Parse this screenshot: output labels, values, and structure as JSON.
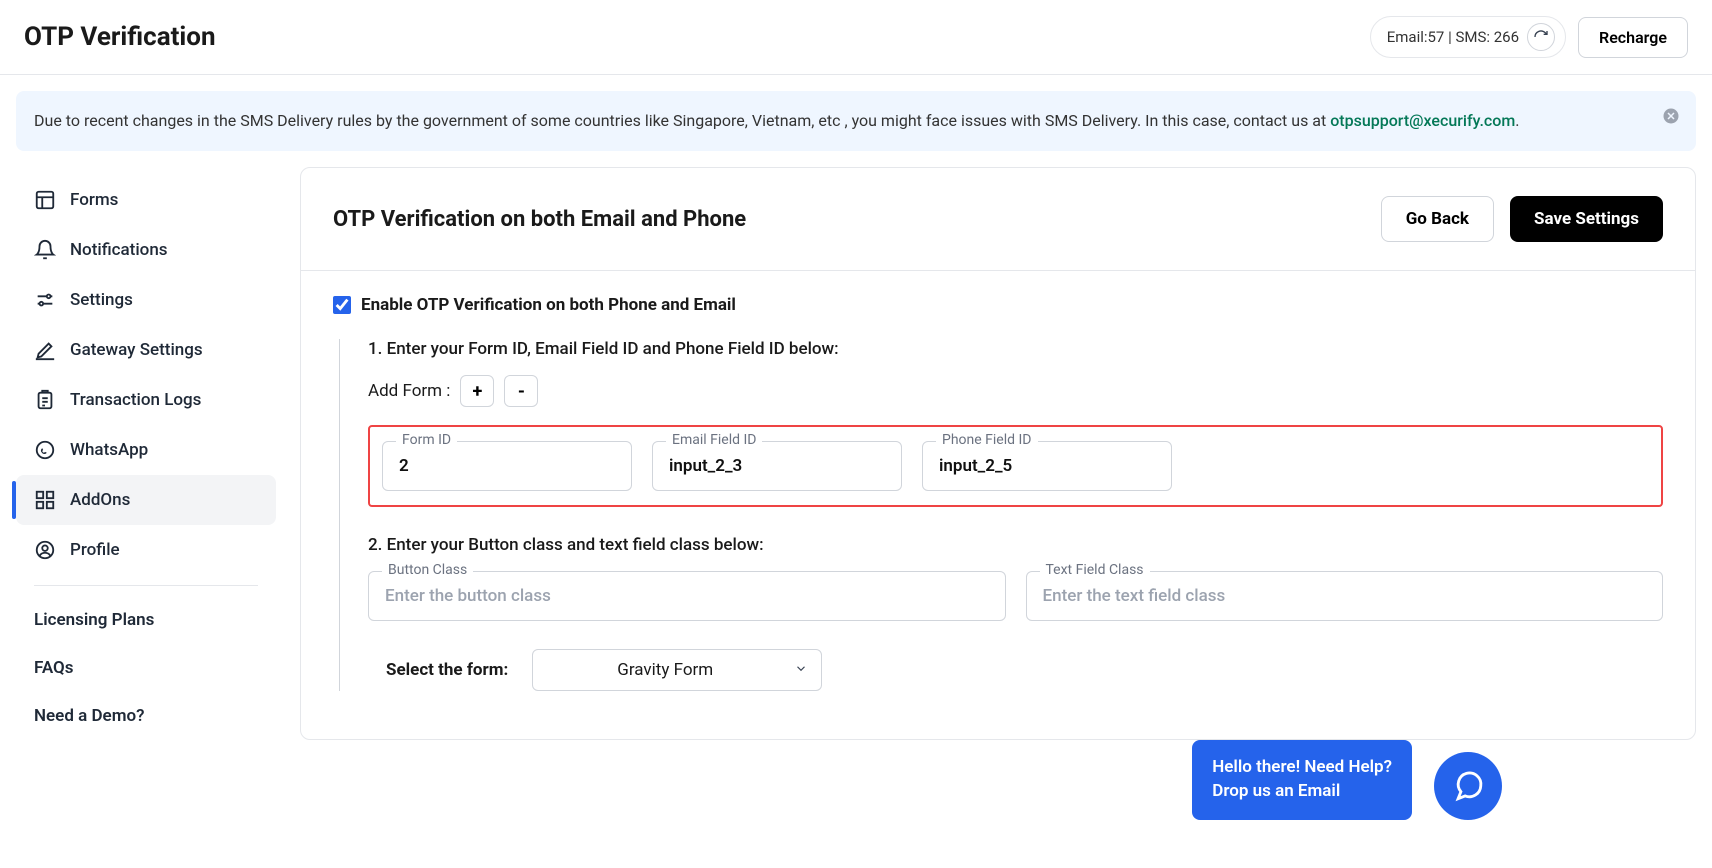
{
  "header": {
    "title": "OTP Verification",
    "quota_text": "Email:57 | SMS: 266",
    "recharge_label": "Recharge"
  },
  "alert": {
    "text": "Due to recent changes in the SMS Delivery rules by the government of some countries like Singapore, Vietnam, etc , you might face issues with SMS Delivery. In this case, contact us at ",
    "email": "otpsupport@xecurify.com",
    "suffix": "."
  },
  "sidebar": {
    "items": [
      {
        "label": "Forms"
      },
      {
        "label": "Notifications"
      },
      {
        "label": "Settings"
      },
      {
        "label": "Gateway Settings"
      },
      {
        "label": "Transaction Logs"
      },
      {
        "label": "WhatsApp"
      },
      {
        "label": "AddOns"
      },
      {
        "label": "Profile"
      }
    ],
    "links": [
      {
        "label": "Licensing Plans"
      },
      {
        "label": "FAQs"
      },
      {
        "label": "Need a Demo?"
      }
    ]
  },
  "main": {
    "title": "OTP Verification on both Email and Phone",
    "go_back_label": "Go Back",
    "save_label": "Save Settings",
    "enable_label": "Enable OTP Verification on both Phone and Email",
    "step1_title": "1. Enter your Form ID, Email Field ID and Phone Field ID below:",
    "add_form_label": "Add Form :",
    "plus_label": "+",
    "minus_label": "-",
    "fields": {
      "form_id_label": "Form ID",
      "form_id_value": "2",
      "email_id_label": "Email Field ID",
      "email_id_value": "input_2_3",
      "phone_id_label": "Phone Field ID",
      "phone_id_value": "input_2_5"
    },
    "step2_title": "2. Enter your Button class and text field class below:",
    "button_class_label": "Button Class",
    "button_class_placeholder": "Enter the button class",
    "text_class_label": "Text Field Class",
    "text_class_placeholder": "Enter the text field class",
    "select_label": "Select the form:",
    "select_value": "Gravity Form"
  },
  "help": {
    "line1": "Hello there! Need Help?",
    "line2": "Drop us an Email"
  }
}
